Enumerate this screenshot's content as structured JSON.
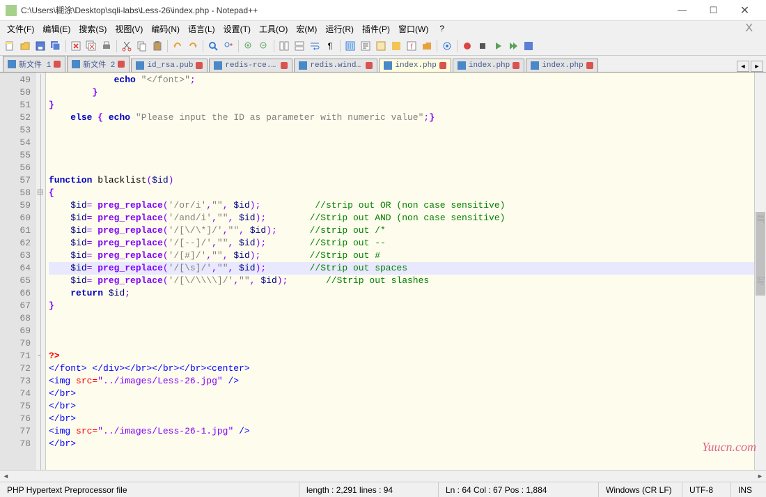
{
  "window": {
    "title": "C:\\Users\\糊涂\\Desktop\\sqli-labs\\Less-26\\index.php - Notepad++"
  },
  "menu": {
    "items": [
      "文件(F)",
      "编辑(E)",
      "搜索(S)",
      "视图(V)",
      "编码(N)",
      "语言(L)",
      "设置(T)",
      "工具(O)",
      "宏(M)",
      "运行(R)",
      "插件(P)",
      "窗口(W)",
      "?"
    ]
  },
  "tabs": [
    {
      "label": "新文件 1",
      "active": false
    },
    {
      "label": "新文件 2",
      "active": false
    },
    {
      "label": "id_rsa.pub",
      "active": false
    },
    {
      "label": "redis-rce.py",
      "active": false
    },
    {
      "label": "redis.windows.conf",
      "active": false
    },
    {
      "label": "index.php",
      "active": true
    },
    {
      "label": "index.php",
      "active": false
    },
    {
      "label": "index.php",
      "active": false
    }
  ],
  "gutter": {
    "start": 49,
    "end": 78
  },
  "code": {
    "lines": [
      {
        "n": 49,
        "html": "            <span class='kw'>echo</span> <span class='str'>\"&lt;/font&gt;\"</span><span class='op'>;</span>"
      },
      {
        "n": 50,
        "html": "        <span class='brace'>}</span>"
      },
      {
        "n": 51,
        "html": "<span class='brace'>}</span>"
      },
      {
        "n": 52,
        "html": "    <span class='kw'>else</span> <span class='brace'>{</span> <span class='kw'>echo</span> <span class='str'>\"Please input the ID as parameter with numeric value\"</span><span class='op'>;</span><span class='brace'>}</span>"
      },
      {
        "n": 53,
        "html": ""
      },
      {
        "n": 54,
        "html": ""
      },
      {
        "n": 55,
        "html": ""
      },
      {
        "n": 56,
        "html": ""
      },
      {
        "n": 57,
        "html": "<span class='kw'>function</span> <span class='fn'>blacklist</span><span class='op'>(</span><span class='var'>$id</span><span class='op'>)</span>"
      },
      {
        "n": 58,
        "html": "<span class='brace'>{</span>",
        "fold": "⊟"
      },
      {
        "n": 59,
        "html": "    <span class='var'>$id</span><span class='op'>=</span> <span class='kw-b'>preg_replace</span><span class='op'>(</span><span class='str'>'/or/i'</span><span class='op'>,</span><span class='str'>\"\"</span><span class='op'>,</span> <span class='var'>$id</span><span class='op'>);</span>          <span class='cmt'>//strip out OR (non case sensitive)</span>"
      },
      {
        "n": 60,
        "html": "    <span class='var'>$id</span><span class='op'>=</span> <span class='kw-b'>preg_replace</span><span class='op'>(</span><span class='str'>'/and/i'</span><span class='op'>,</span><span class='str'>\"\"</span><span class='op'>,</span> <span class='var'>$id</span><span class='op'>);</span>        <span class='cmt'>//Strip out AND (non case sensitive)</span>"
      },
      {
        "n": 61,
        "html": "    <span class='var'>$id</span><span class='op'>=</span> <span class='kw-b'>preg_replace</span><span class='op'>(</span><span class='str'>'/[\\/\\*]/'</span><span class='op'>,</span><span class='str'>\"\"</span><span class='op'>,</span> <span class='var'>$id</span><span class='op'>);</span>      <span class='cmt'>//strip out /*</span>"
      },
      {
        "n": 62,
        "html": "    <span class='var'>$id</span><span class='op'>=</span> <span class='kw-b'>preg_replace</span><span class='op'>(</span><span class='str'>'/[--]/'</span><span class='op'>,</span><span class='str'>\"\"</span><span class='op'>,</span> <span class='var'>$id</span><span class='op'>);</span>        <span class='cmt'>//Strip out --</span>"
      },
      {
        "n": 63,
        "html": "    <span class='var'>$id</span><span class='op'>=</span> <span class='kw-b'>preg_replace</span><span class='op'>(</span><span class='str'>'/[#]/'</span><span class='op'>,</span><span class='str'>\"\"</span><span class='op'>,</span> <span class='var'>$id</span><span class='op'>);</span>         <span class='cmt'>//Strip out #</span>"
      },
      {
        "n": 64,
        "html": "    <span class='var'>$id</span><span class='op'>=</span> <span class='kw-b'>preg_replace</span><span class='op'>(</span><span class='str'>'/[\\s]/'</span><span class='op'>,</span><span class='str'>\"\"</span><span class='op'>,</span> <span class='var'>$id</span><span class='op'>);</span>        <span class='cmt'>//Strip out spaces</span>",
        "hl": true
      },
      {
        "n": 65,
        "html": "    <span class='var'>$id</span><span class='op'>=</span> <span class='kw-b'>preg_replace</span><span class='op'>(</span><span class='str'>'/[\\/\\\\\\\\]/'</span><span class='op'>,</span><span class='str'>\"\"</span><span class='op'>,</span> <span class='var'>$id</span><span class='op'>);</span>       <span class='cmt'>//Strip out slashes</span>"
      },
      {
        "n": 66,
        "html": "    <span class='kw'>return</span> <span class='var'>$id</span><span class='op'>;</span>"
      },
      {
        "n": 67,
        "html": "<span class='brace'>}</span>"
      },
      {
        "n": 68,
        "html": ""
      },
      {
        "n": 69,
        "html": ""
      },
      {
        "n": 70,
        "html": ""
      },
      {
        "n": 71,
        "html": "<span class='php-tag'>?&gt;</span>",
        "fold": "-"
      },
      {
        "n": 72,
        "html": "<span class='tag'>&lt;/font&gt;</span> <span class='tag'>&lt;/div&gt;&lt;/br&gt;&lt;/br&gt;&lt;/br&gt;&lt;center&gt;</span>"
      },
      {
        "n": 73,
        "html": "<span class='tag'>&lt;img</span> <span class='attr'>src=</span><span class='aval'>\"../images/Less-26.jpg\"</span> <span class='tag'>/&gt;</span>"
      },
      {
        "n": 74,
        "html": "<span class='tag'>&lt;/br&gt;</span>"
      },
      {
        "n": 75,
        "html": "<span class='tag'>&lt;/br&gt;</span>"
      },
      {
        "n": 76,
        "html": "<span class='tag'>&lt;/br&gt;</span>"
      },
      {
        "n": 77,
        "html": "<span class='tag'>&lt;img</span> <span class='attr'>src=</span><span class='aval'>\"../images/Less-26-1.jpg\"</span> <span class='tag'>/&gt;</span>"
      },
      {
        "n": 78,
        "html": "<span class='tag'>&lt;/br&gt;</span>"
      }
    ]
  },
  "status": {
    "filetype": "PHP Hypertext Preprocessor file",
    "length": "length : 2,291    lines : 94",
    "pos": "Ln : 64    Col : 67    Pos : 1,884",
    "eol": "Windows (CR LF)",
    "encoding": "UTF-8",
    "mode": "INS"
  },
  "watermark": "Yuucn.com"
}
